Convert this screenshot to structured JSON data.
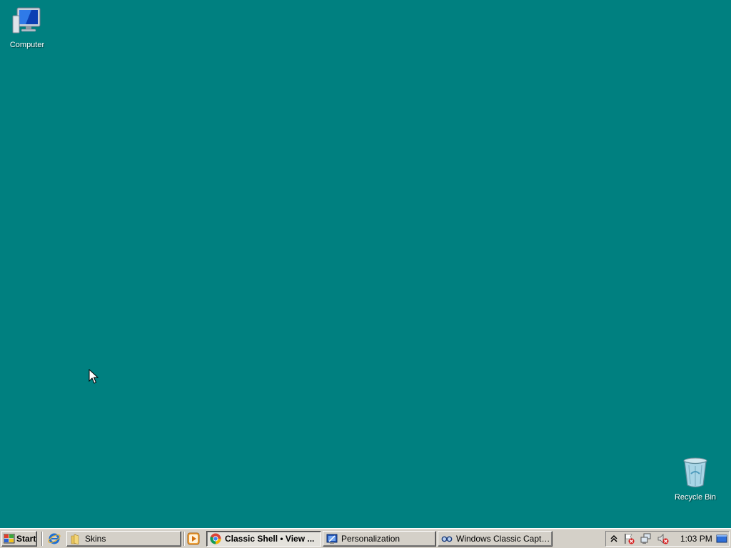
{
  "desktop": {
    "background": "#008080",
    "icons": [
      {
        "label": "Computer",
        "icon": "computer-icon"
      },
      {
        "label": "Recycle Bin",
        "icon": "recycle-bin-icon"
      }
    ]
  },
  "taskbar": {
    "start_label": "Start",
    "quick_launch": [
      {
        "icon": "internet-explorer-icon"
      },
      {
        "icon": "media-player-icon"
      }
    ],
    "buttons": [
      {
        "label": "Skins",
        "icon": "folder-icon",
        "active": false
      },
      {
        "label": "Classic Shell • View ...",
        "icon": "chrome-icon",
        "active": true
      },
      {
        "label": "Personalization",
        "icon": "personalization-icon",
        "active": false
      },
      {
        "label": "Windows Classic Caption...",
        "icon": "glasses-icon",
        "active": false
      }
    ],
    "tray": {
      "icons": [
        "show-hidden-icons-chevron",
        "action-center-flag-icon",
        "network-icon",
        "volume-muted-icon",
        "show-desktop-icon"
      ],
      "clock": "1:03 PM"
    }
  }
}
